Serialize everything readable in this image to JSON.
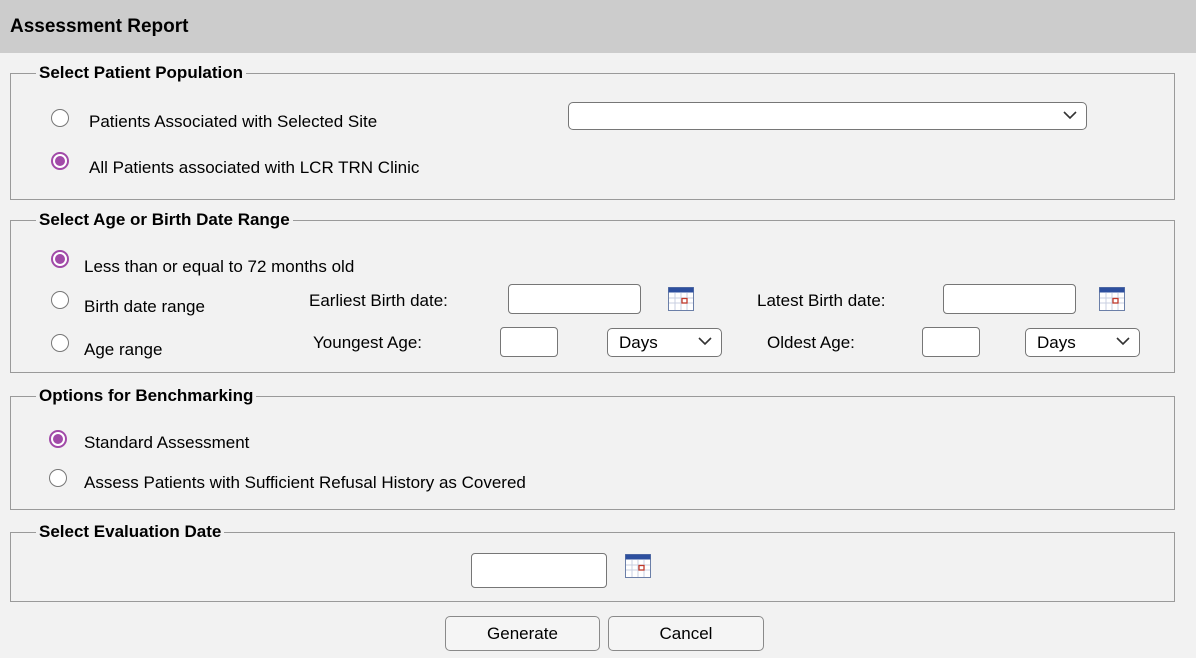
{
  "header": {
    "title": "Assessment Report"
  },
  "population": {
    "legend": "Select Patient Population",
    "option_site": {
      "label": "Patients Associated with Selected Site",
      "checked": false
    },
    "option_all": {
      "label": "All Patients associated with LCR TRN Clinic",
      "checked": true
    },
    "site_select_value": ""
  },
  "age": {
    "legend": "Select Age or Birth Date Range",
    "option_months": {
      "label": "Less than or equal to 72 months old",
      "checked": true
    },
    "option_birth": {
      "label": "Birth date range",
      "checked": false
    },
    "option_age": {
      "label": "Age range",
      "checked": false
    },
    "earliest_label": "Earliest Birth date:",
    "latest_label": "Latest Birth date:",
    "earliest_value": "",
    "latest_value": "",
    "youngest_label": "Youngest Age:",
    "oldest_label": "Oldest Age:",
    "youngest_value": "",
    "oldest_value": "",
    "youngest_unit": "Days",
    "oldest_unit": "Days"
  },
  "benchmark": {
    "legend": "Options for Benchmarking",
    "option_standard": {
      "label": "Standard Assessment",
      "checked": true
    },
    "option_refusal": {
      "label": "Assess Patients with Sufficient Refusal History as Covered",
      "checked": false
    }
  },
  "evaluation": {
    "legend": "Select Evaluation Date",
    "date_value": ""
  },
  "buttons": {
    "generate": "Generate",
    "cancel": "Cancel"
  },
  "colors": {
    "header_bg": "#cccccc",
    "page_bg": "#f2f2f2",
    "radio_checked": "#a14aa8"
  },
  "icons": {
    "calendar": "calendar-icon",
    "chevron": "chevron-down-icon"
  }
}
